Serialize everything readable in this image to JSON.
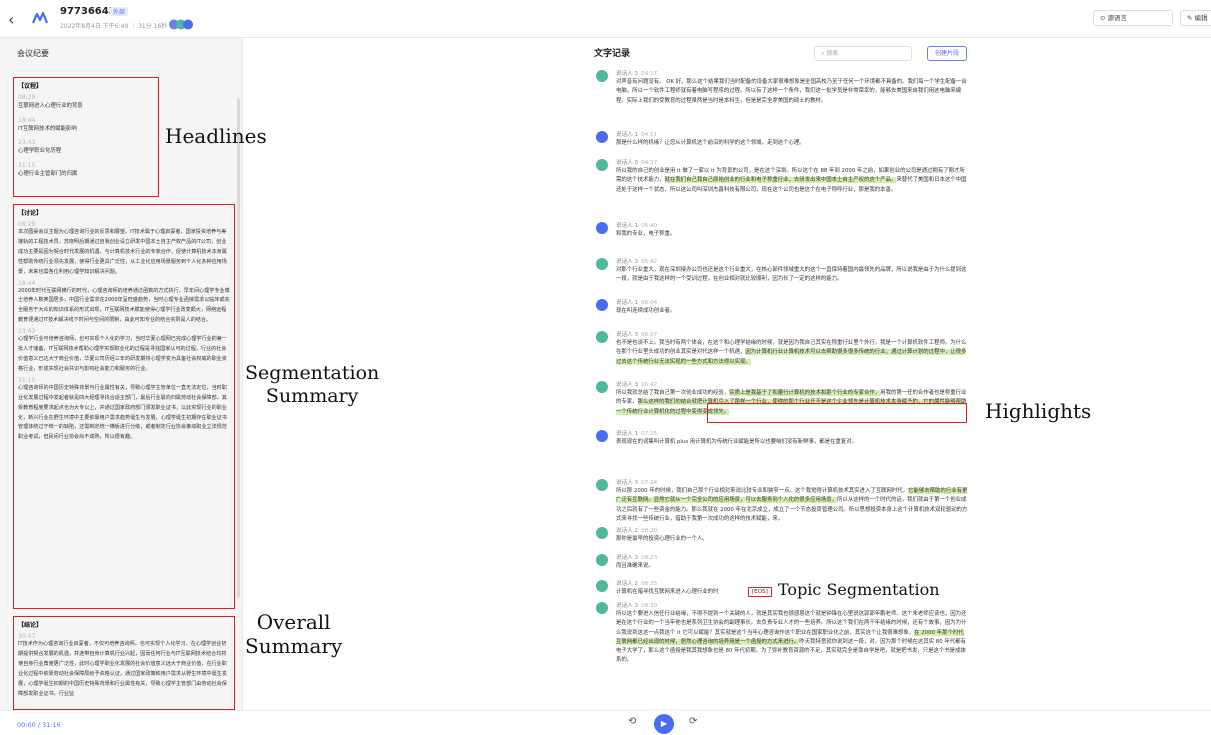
{
  "header": {
    "meeting_id": "977366438",
    "tag": "外部",
    "meta": "2022年8月4日 下午5:49 ｜ 31分 16秒 ｜",
    "source_lang_btn": "⊙ 源语言",
    "edit_btn": "✎ 编辑"
  },
  "left": {
    "title": "会议纪要",
    "agenda": {
      "head": "【议程】",
      "items": [
        {
          "time": "08:29",
          "text": "互联网进入心理行业的背景"
        },
        {
          "time": "18:44",
          "text": "IT互联网技术的赋能影响"
        },
        {
          "time": "23:43",
          "text": "心理学职业化历程"
        },
        {
          "time": "31:15",
          "text": "心理行业主管部门的归属"
        }
      ]
    },
    "discussion": {
      "head": "【讨论】",
      "items": [
        {
          "time": "08:29",
          "text": "本次圆桌会议主题为心理咨询行业的反思和展望。IT技术属于心理启蒙者，国家投资培养与美接轨的工程技术员，苏晓明后期通过自我创业设立研发中国本土自主产权产品的IT公司，创业成功主要是因为契合时代发展的机遇，与计算机技术行业的专家合作，促使计算机技术本身属性帮助传统行业领先发展，使得行业更具广泛性，从工业化应用场景服务到个人化多种应用场景，未来也需各位利用心理学知识解决问题。"
        },
        {
          "time": "18:44",
          "text": "2000年时代互联网横行的时代，心理咨询师的培养通过函数的方式执行，早年间心理学专业博士培养人数奥国居多，中国行业需求在2000年呈旺盛趋势，当时心理专业函授需求以临床或完全服务于大众的知识体系的形式出现，IT互联网技术赋能使得心理学行业改变颇大，网络远程教育便通过IT技术解决线下时间与空间的限制，由此可知专业的结合实则是人的结合。"
        },
        {
          "time": "23:43",
          "text": "心理学行业可培养咨询师，也可实现个人化的学习，当时华夏心理网已完成心理学行业的第一批人才储备，IT互联网技术帮助心理学实现职业化的过程是寻找国家认可的过程，行业的社会价值意义已达大于商业价值，华夏公司历经三年的研发期将心理学变为具备社会权威的职业资格行业，形成实现社会共识与影响社会能力和服务的行业。"
        },
        {
          "time": "31:15",
          "text": "心理咨询师的中国历史特殊背景与行业属性有关，导致心理学主管单位一直无法定位，当时职业化发展过程中发起者就是四大经理寻找合适主部门，最后行业最向归属劳动社会保障部，其受教育程度要求起点也为大专以上，并通过国家政府部门颁发职业证书，以此实现行业的职业化，新兴行业在野生环境中主要依靠用户需求趋势诞生与发展，心理学诞生初期存在职业证书管理体统过于统一的缺陷，还需制定统一横板进行分级，或者制定行业协会推动职业立法规范职业考试，但民间行业协会尚不成熟，所以很有趣。"
        }
      ]
    },
    "conclusion": {
      "head": "【结论】",
      "time": "30:47",
      "text": "IT技术作为心理咨询行业启蒙者，不仅可培养咨询师，也可实现个人化学习，在心理学创业初期提供契合发展的机遇，并连带自身计算机行业兴起，因而任何行业与IT互联网技术结合均将使自身行业角度更广泛性，此时心理学职业化发展的社会价值意义远大于商业价值，在行业职业化过程中依靠劳动社会保障局给予资格认证，通过国家政策和用户需求从野生环境中诞生发展，心理学诞生初期的中国历史特殊背景和行业属性有关，导致心理学主管部门由劳动社会保障部发职业证书，行业监"
    }
  },
  "annotations": {
    "headlines": "Headlines",
    "segmentation": "Segmentation\nSummary",
    "overall": "Overall\nSummary",
    "highlights": "Highlights",
    "topic": "Topic Segmentation"
  },
  "right": {
    "title": "文字记录",
    "search_placeholder": "搜索",
    "create_btn": "创建片段",
    "utterances": [
      {
        "speaker": "说话人 3",
        "time": "04:17",
        "color": "g",
        "parts": [
          {
            "t": "对声音有问题没有。 OK 好。那么这个结果我们当时配备的设备大家很难想象是全国高校乃至于任何一个环境都不具备的。我们每一个学生配备一台电脑，所以一个软件工程师就有着电脑写程序的过程。所以有了这样一个条件，我们这一批学员是非常荣幸的，能够去美国来自我们用这电脑来编程。实际上我们的受教育的过程虽然是当时是本科生，但是是完全拿美国的硕士的教材。"
          }
        ]
      },
      {
        "speaker": "说话人 1",
        "time": "04:51",
        "color": "b",
        "parts": [
          {
            "t": "那是什么样的机缘？让您从计算机这个前沿的科学的这个领域，走到这个心理。"
          }
        ]
      },
      {
        "speaker": "说话人 3",
        "time": "04:57",
        "color": "g",
        "parts": [
          {
            "t": "所以我的自己的创业是用 it 做了一家以 it 为背景的公司，是在这个深圳。所以这个在 88 年到 2000 年之前，如果创业的公司是通过拥有了刚才所需的这个技术能力，"
          },
          {
            "t": "就在我们自己我自己原始创业的行业和电子称重行业，去研发出来中国本土自主产权的这个产品。",
            "h": true
          },
          {
            "t": "来替代了美国和日本这个中国还处于这样一个状态，所以这公司叫深圳杰鑫科技有限公司，现在这个公司也是这个在电子称呼行业，那是我的本善。"
          }
        ]
      },
      {
        "speaker": "说话人 1",
        "time": "05:40",
        "color": "b",
        "parts": [
          {
            "t": "和我的专业，电子称重。"
          }
        ]
      },
      {
        "speaker": "说话人 3",
        "time": "05:42",
        "color": "g",
        "parts": [
          {
            "t": "对那个行业重大，现在深圳接办公司也还是这个行业重大，在核心部件领域重大的这个一直保持着国内最领先的品牌，所以说我是由于为什么提到这一段，就是由于我这样的一个受训过程，在创业相对就比较顺利，因为长了一定的这样的能力。"
          }
        ]
      },
      {
        "speaker": "说话人 1",
        "time": "06:04",
        "color": "b",
        "parts": [
          {
            "t": "现在叫连续成功创业者。"
          }
        ]
      },
      {
        "speaker": "说话人 3",
        "time": "06:07",
        "color": "g",
        "parts": [
          {
            "t": "也不是也谈不上。我当时有两个体会，在这个和心理学结缘的时候，就是因为我自己其实在称重行业里个外行，我是一个计算机软件工程师。为什么在那个行业里头成功的创业其实是对代这样一个机遇，"
          },
          {
            "t": "因为计算机行业计算机技术可以去帮助很多很多传统的行业，通过计算计划的过程中，让很多过去这个传统行业无法实现的一些方式和方法得以实现。",
            "h": true
          }
        ]
      },
      {
        "speaker": "说话人 3",
        "time": "06:42",
        "color": "g",
        "parts": [
          {
            "t": "所以我就总结了我自己第一次创业成功的经验，"
          },
          {
            "t": "实质上是我基于了和量行计算机的技术和那个行业的专家合作，",
            "h": true
          },
          {
            "t": "用我的第一任的合作者也是称重行业的专家，"
          },
          {
            "t": "那么这样的我们的结合就把计算机引入了那样一个行业，使得的那个行业开不是这个企业领先是计算机技术本身赋予的，它的属性能够帮助一个传统行业计算机化的过程中变得变成领先。",
            "h": true
          }
        ]
      },
      {
        "speaker": "说话人 1",
        "time": "07:15",
        "color": "b",
        "parts": [
          {
            "t": "表现现在的词集叫计算机 plus 用计算机为传统行业赋能是所以也要咱们没有新鲜事，都是在重复对。"
          }
        ]
      },
      {
        "speaker": "说话人 3",
        "time": "07:24",
        "color": "g",
        "parts": [
          {
            "t": "所以那 2000 年的时候，我们自己那个行业相对来说比较专业和狭窄一点。这个我觉得计算机技术其实进入了互联网时代，"
          },
          {
            "t": "它能够去帮助的行业有更广泛有互联网。显然它就从一个完全公司的应用场景，可以去服务到个人化的很多应用场景，",
            "h": true
          },
          {
            "t": "所以从这样的一个时代的话，我们就由于第一个创业成功之后就有了一些资金的能力。那么我就在 2000 年在北京成立，成立了一个节态投资管理公司。所以思想投资本身上这个计算机技术双轮驱动的方式来寻找一些传统行业，借助于我第一次成功的这样的技术赋能，来。"
          }
        ]
      },
      {
        "speaker": "说话人 2",
        "time": "08:20",
        "color": "g",
        "parts": [
          {
            "t": "那你是最早的投资心理行业的一个人。"
          }
        ]
      },
      {
        "speaker": "说话人 3",
        "time": "08:23",
        "color": "g",
        "parts": [
          {
            "t": "而且准确来说。"
          }
        ]
      },
      {
        "speaker": "说话人 2",
        "time": "08:25",
        "color": "g",
        "parts": [
          {
            "t": "计算机在暗寻找互联网来进入心理行业的时"
          }
        ]
      },
      {
        "speaker": "说话人 3",
        "time": "08:30",
        "color": "g",
        "parts": [
          {
            "t": "所以这个要进入信任行业结缘，不得不提到一个关键的人，就是其实我也很感恩这个就是钟锋在心里说这郭郭年鹏老师。这个朱老师应该也，因为还是在这个行业的一个当年他也是系列卫生协会的副理事长。去负责专业人才的一些培养。所以这个我们在两千年结缘的时候，还有个故事，因为为什么我说到这这一点我这个 it 它可以赋能？其实就是这个当年心理咨询作这个职业在国家职业化之前，其实这个让我很难想象，"
          },
          {
            "t": "在 2000 年那个时代互联网都已经出现的时候，居然心理咨询的培养用是一个函授的方式来进行。",
            "h": true
          },
          {
            "t": "昨天我特意就你说到这一段，对。因为那个时候在这其实 80 年代都有电子大学了，那么这个函授是我其我想象也是 80 年代初期，为了弥补教育资源的不足，其实就完全是靠自学是吧，就是把书发，只是这个书是成体系的。"
          }
        ]
      }
    ],
    "eos_tag": "[EOS]"
  },
  "player": {
    "time": "00:00 / 31:16",
    "rewind": "⟲",
    "play": "▶",
    "forward": "⟳"
  }
}
